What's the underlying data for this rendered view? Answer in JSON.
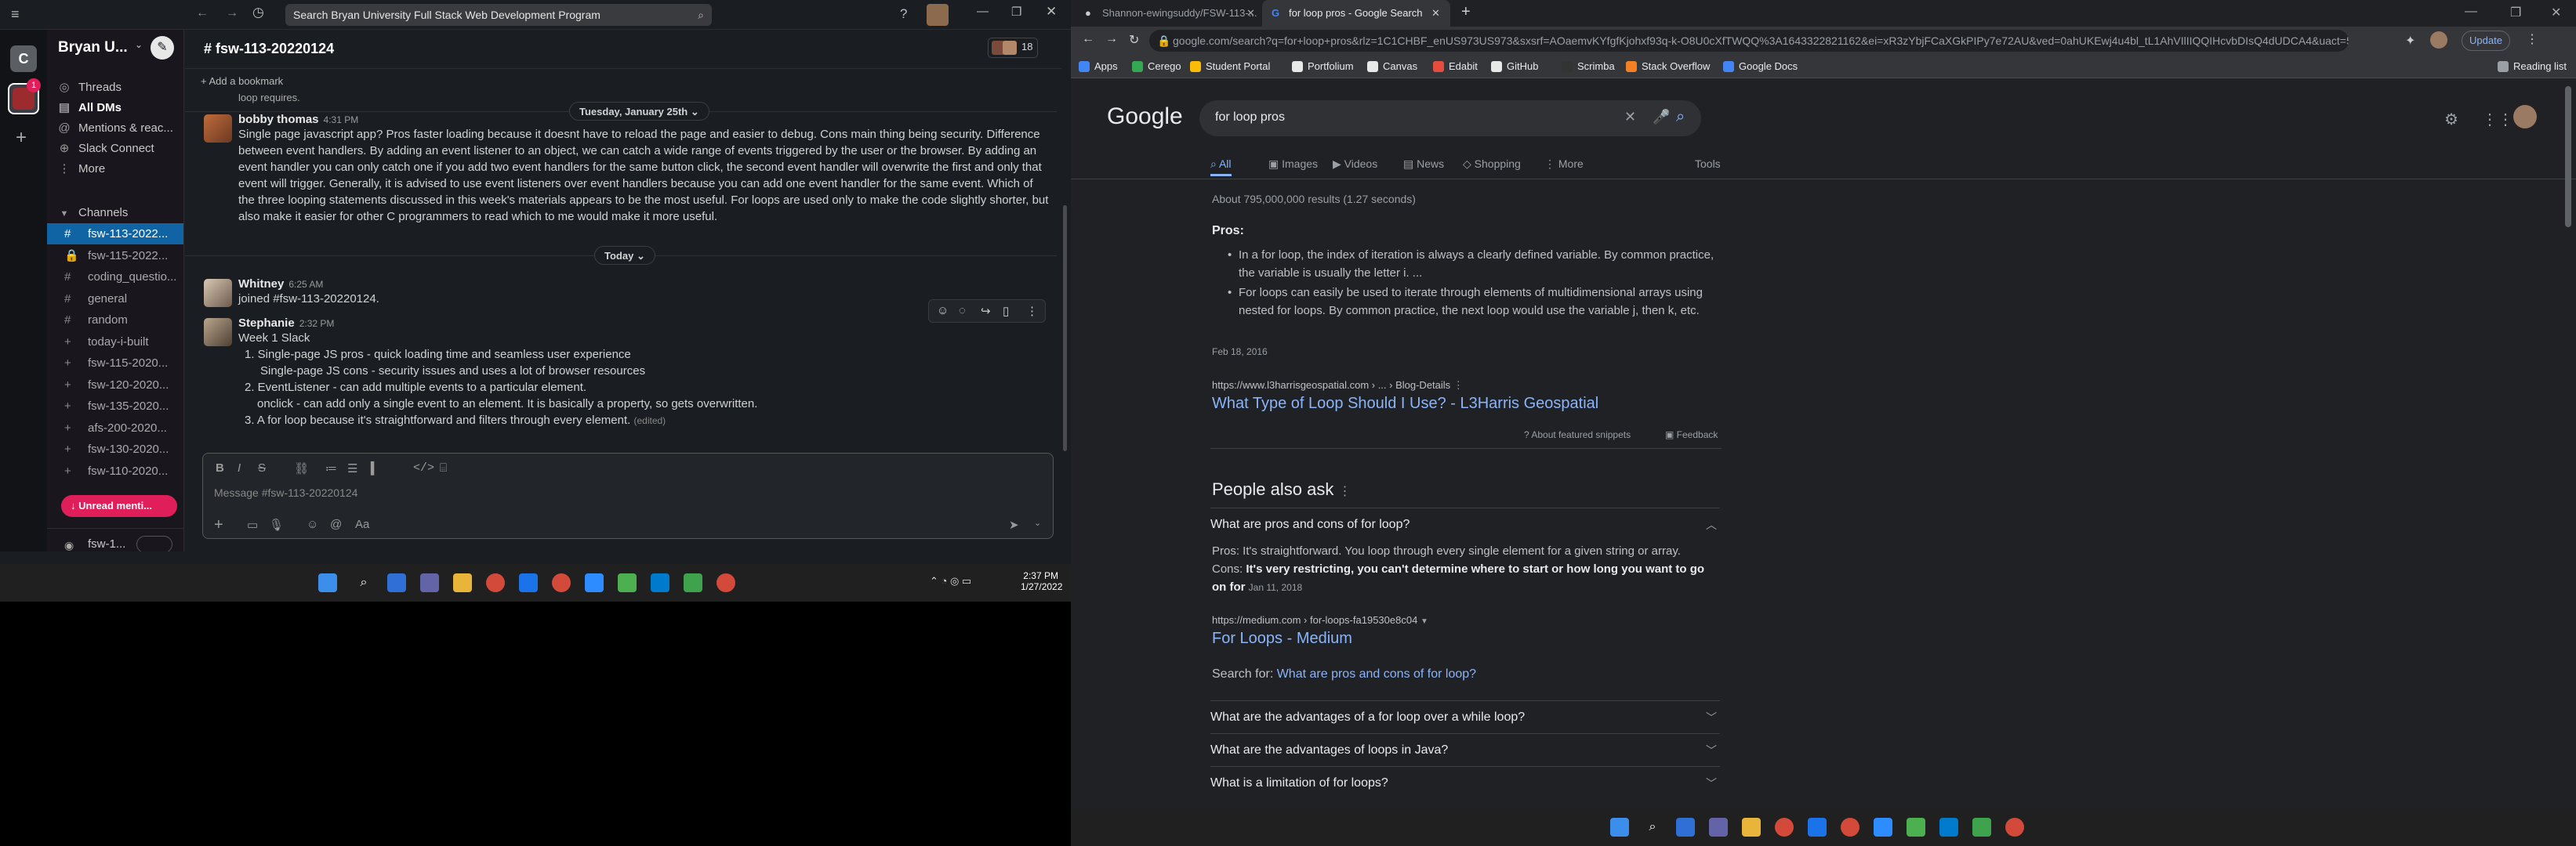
{
  "slack": {
    "workspace_name": "Bryan U...",
    "search_placeholder": "Search Bryan University Full Stack Web Development Program",
    "rail_initials": "C",
    "rail_badge": "1",
    "nav": [
      "Threads",
      "All DMs",
      "Mentions & reac...",
      "Slack Connect",
      "More"
    ],
    "channels_heading": "Channels",
    "channels": [
      "fsw-113-2022...",
      "fsw-115-2022...",
      "coding_questio...",
      "general",
      "random",
      "today-i-built",
      "fsw-115-2020...",
      "fsw-120-2020...",
      "fsw-135-2020...",
      "afs-200-2020...",
      "fsw-130-2020...",
      "fsw-110-2020..."
    ],
    "unread_button": "Unread menti...",
    "footer_user": "fsw-1...",
    "channel_title": "# fsw-113-20220124",
    "member_count": "18",
    "add_bookmark": "Add a bookmark",
    "cut_text": "loop requires.",
    "day1": "Tuesday, January 25th",
    "msg1": {
      "author": "bobby thomas",
      "time": "4:31 PM",
      "text": "Single page javascript app? Pros faster loading because it doesnt have to reload the page and easier to debug. Cons main thing being security.  Difference between event handlers. By adding an event listener to an object, we can catch a wide range of events triggered by the user or the browser. By adding an event handler you can only catch one if you add two event handlers for the same button click, the second event handler will overwrite the first and only that event will trigger. Generally, it is advised to use event listeners over event handlers because you can add one event handler for the same event. Which of the three looping statements discussed in this week's materials appears to be the most useful. For loops are used only to make the code slightly shorter, but also make it easier for other C programmers to read which to me would make it more useful."
    },
    "day2": "Today",
    "msg2": {
      "author": "Whitney",
      "time": "6:25 AM",
      "text": "joined #fsw-113-20220124."
    },
    "msg3": {
      "author": "Stephanie",
      "time": "2:32 PM",
      "line0": "Week 1 Slack",
      "l1": "1.   Single-page JS pros - quick loading time and seamless user experience",
      "l1b": "Single-page JS cons - security issues and uses a lot of browser resources",
      "l2": "2.  EventListener - can add multiple events to a particular element.",
      "l2b": "onclick - can add only a single event to an element. It is basically a property, so gets overwritten.",
      "l3": "3.  A for loop because it's straightforward and filters through every element.",
      "edited": "(edited)"
    },
    "composer_placeholder": "Message #fsw-113-20220124",
    "clock_time": "2:37 PM",
    "clock_date": "1/27/2022"
  },
  "chrome": {
    "tabs": [
      "Shannon-ewingsuddy/FSW-113-...",
      "for loop pros - Google Search"
    ],
    "url": "google.com/search?q=for+loop+pros&rlz=1C1CHBF_enUS973US973&sxsrf=AOaemvKYfgfKjohxf93q-k-O8U0cXfTWQQ%3A1643322821162&ei=xR3zYbjFCaXGkPIPy7e72AU&ved=0ahUKEwj4u4bl_tL1AhVIlIIQQIHcvbDIsQ4dUDCA4&uact=5&oq=for+l...",
    "update_label": "Update",
    "bookmarks": [
      "Apps",
      "Cerego",
      "Student Portal",
      "Portfolium",
      "Canvas",
      "Edabit",
      "GitHub",
      "Scrimba",
      "Stack Overflow",
      "Google Docs"
    ],
    "reading_list": "Reading list",
    "logo": "Google",
    "query": "for loop pros",
    "gtabs": [
      "All",
      "Images",
      "Videos",
      "News",
      "Shopping",
      "More",
      "Tools"
    ],
    "results_count": "About 795,000,000 results (1.27 seconds)",
    "pros_heading": "Pros:",
    "pros_item1": "In a for loop, the index of iteration is always a clearly defined variable. By common practice, the variable is usually the letter i. ...",
    "pros_item2": "For loops can easily be used to iterate through elements of multidimensional arrays using nested for loops. By common practice, the next loop would use the variable j, then k, etc.",
    "snippet_date": "Feb 18, 2016",
    "result1_url": "https://www.l3harrisgeospatial.com › ... › Blog-Details",
    "result1_title": "What Type of Loop Should I Use? - L3Harris Geospatial",
    "about_snippets": "About featured snippets",
    "feedback": "Feedback",
    "paa_heading": "People also ask",
    "paa_q1": "What are pros and cons of for loop?",
    "paa_a1_pros": "Pros: It's straightforward. You loop through every single element for a given string or array.",
    "paa_a1_cons_prefix": "Cons: ",
    "paa_a1_cons_bold": "It's very restricting, you can't determine where to start or how long you want to go on for",
    "paa_a1_date": "Jan 11, 2018",
    "result2_url": "https://medium.com › for-loops-fa19530e8c04",
    "result2_title": "For Loops - Medium",
    "search_for_prefix": "Search for: ",
    "search_for_link": "What are pros and cons of for loop?",
    "paa_q2": "What are the advantages of a for loop over a while loop?",
    "paa_q3": "What are the advantages of loops in Java?",
    "paa_q4": "What is a limitation of for loops?"
  },
  "colors": {
    "slack_bg": "#1a1d21",
    "slack_active": "#1164a3",
    "unread_red": "#e01e5a",
    "google_link": "#8ab4f8",
    "google_bg": "#202124"
  }
}
